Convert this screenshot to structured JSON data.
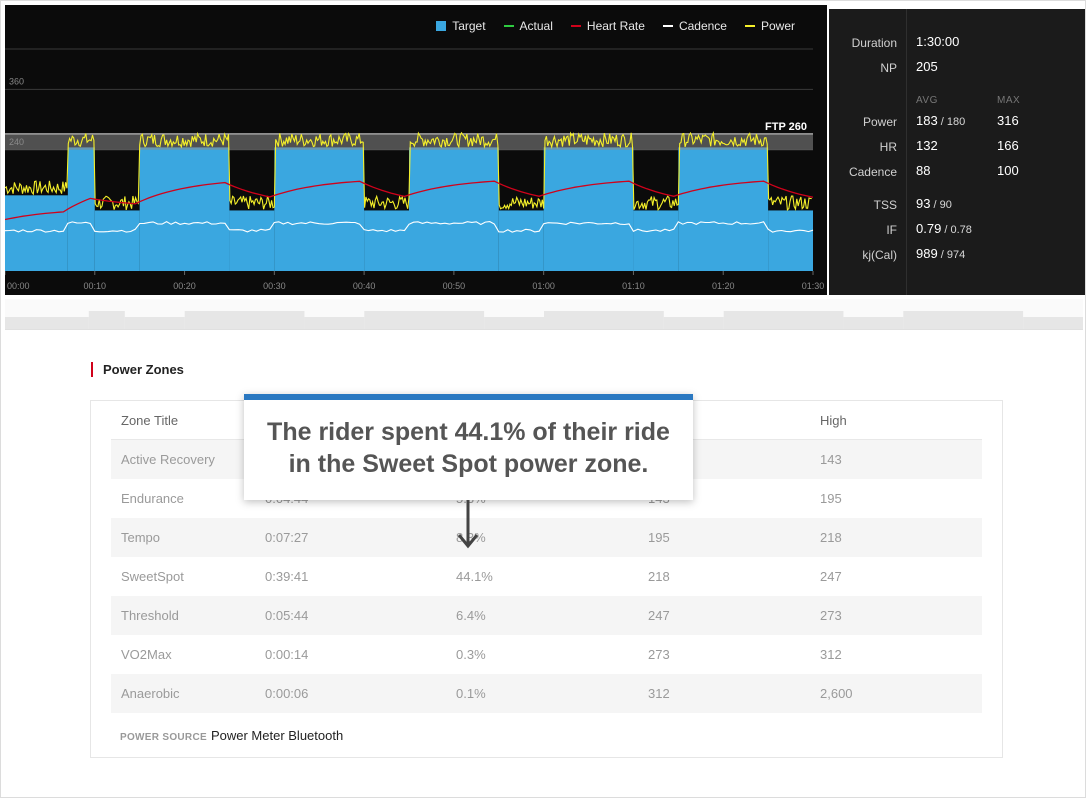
{
  "legend": [
    {
      "label": "Target",
      "color": "#3aa7e0",
      "kind": "box"
    },
    {
      "label": "Actual",
      "color": "#2ecc40",
      "kind": "line"
    },
    {
      "label": "Heart Rate",
      "color": "#d0021b",
      "kind": "line"
    },
    {
      "label": "Cadence",
      "color": "#ffffff",
      "kind": "line"
    },
    {
      "label": "Power",
      "color": "#f5f02a",
      "kind": "line"
    }
  ],
  "chart_data": {
    "type": "area",
    "y_ticks": [
      "360",
      "240"
    ],
    "x_ticks": [
      "00:00",
      "00:10",
      "00:20",
      "00:30",
      "00:40",
      "00:50",
      "01:00",
      "01:10",
      "01:20",
      "01:30"
    ],
    "ftp_label": "FTP 260",
    "ftp_value": 260,
    "ylim": [
      0,
      440
    ],
    "x_range_minutes": [
      0,
      90
    ],
    "target_segments": [
      {
        "start": 0,
        "end": 7,
        "value": 150
      },
      {
        "start": 7,
        "end": 10,
        "value": 245
      },
      {
        "start": 10,
        "end": 15,
        "value": 120
      },
      {
        "start": 15,
        "end": 25,
        "value": 245
      },
      {
        "start": 25,
        "end": 30,
        "value": 120
      },
      {
        "start": 30,
        "end": 40,
        "value": 245
      },
      {
        "start": 40,
        "end": 45,
        "value": 120
      },
      {
        "start": 45,
        "end": 55,
        "value": 245
      },
      {
        "start": 55,
        "end": 60,
        "value": 120
      },
      {
        "start": 60,
        "end": 70,
        "value": 245
      },
      {
        "start": 70,
        "end": 75,
        "value": 120
      },
      {
        "start": 75,
        "end": 85,
        "value": 245
      },
      {
        "start": 85,
        "end": 90,
        "value": 120
      }
    ]
  },
  "stats": {
    "duration_label": "Duration",
    "duration_value": "1:30:00",
    "np_label": "NP",
    "np_value": "205",
    "avg_header": "AVG",
    "max_header": "MAX",
    "power_label": "Power",
    "power_avg": "183",
    "power_avg_target": " / 180",
    "power_max": "316",
    "hr_label": "HR",
    "hr_avg": "132",
    "hr_max": "166",
    "cadence_label": "Cadence",
    "cadence_avg": "88",
    "cadence_max": "100",
    "tss_label": "TSS",
    "tss_value": "93",
    "tss_target": " / 90",
    "if_label": "IF",
    "if_value": "0.79",
    "if_target": " / 0.78",
    "kj_label": "kj(Cal)",
    "kj_value": "989",
    "kj_target": " / 974"
  },
  "zones": {
    "title": "Power Zones",
    "headers": [
      "Zone Title",
      "",
      "",
      "",
      "High"
    ],
    "rows": [
      [
        "Active Recovery",
        "",
        "",
        "",
        "143"
      ],
      [
        "Endurance",
        "0:04:44",
        "5.3%",
        "143",
        "195"
      ],
      [
        "Tempo",
        "0:07:27",
        "8.3%",
        "195",
        "218"
      ],
      [
        "SweetSpot",
        "0:39:41",
        "44.1%",
        "218",
        "247"
      ],
      [
        "Threshold",
        "0:05:44",
        "6.4%",
        "247",
        "273"
      ],
      [
        "VO2Max",
        "0:00:14",
        "0.3%",
        "273",
        "312"
      ],
      [
        "Anaerobic",
        "0:00:06",
        "0.1%",
        "312",
        "2,600"
      ]
    ],
    "power_source_label": "POWER SOURCE",
    "power_source_value": "Power Meter Bluetooth"
  },
  "callout": {
    "line1": "The rider spent 44.1% of their ride",
    "line2": "in the Sweet Spot power zone."
  }
}
